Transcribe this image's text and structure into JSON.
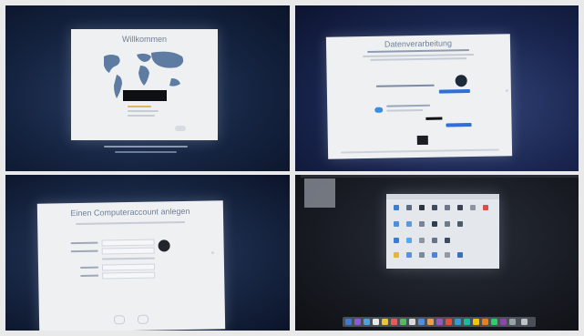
{
  "panels": {
    "welcome": {
      "title": "Willkommen"
    },
    "privacy": {
      "title": "Datenverarbeitung"
    },
    "account": {
      "title": "Einen Computeraccount anlegen"
    }
  },
  "colors": {
    "screen_bg": "#eef0f2",
    "title_text": "#6f7f98",
    "map_blue": "#4f6f9a",
    "accent_blue": "#2f6fd6",
    "desktop_dark": "#14161b"
  }
}
